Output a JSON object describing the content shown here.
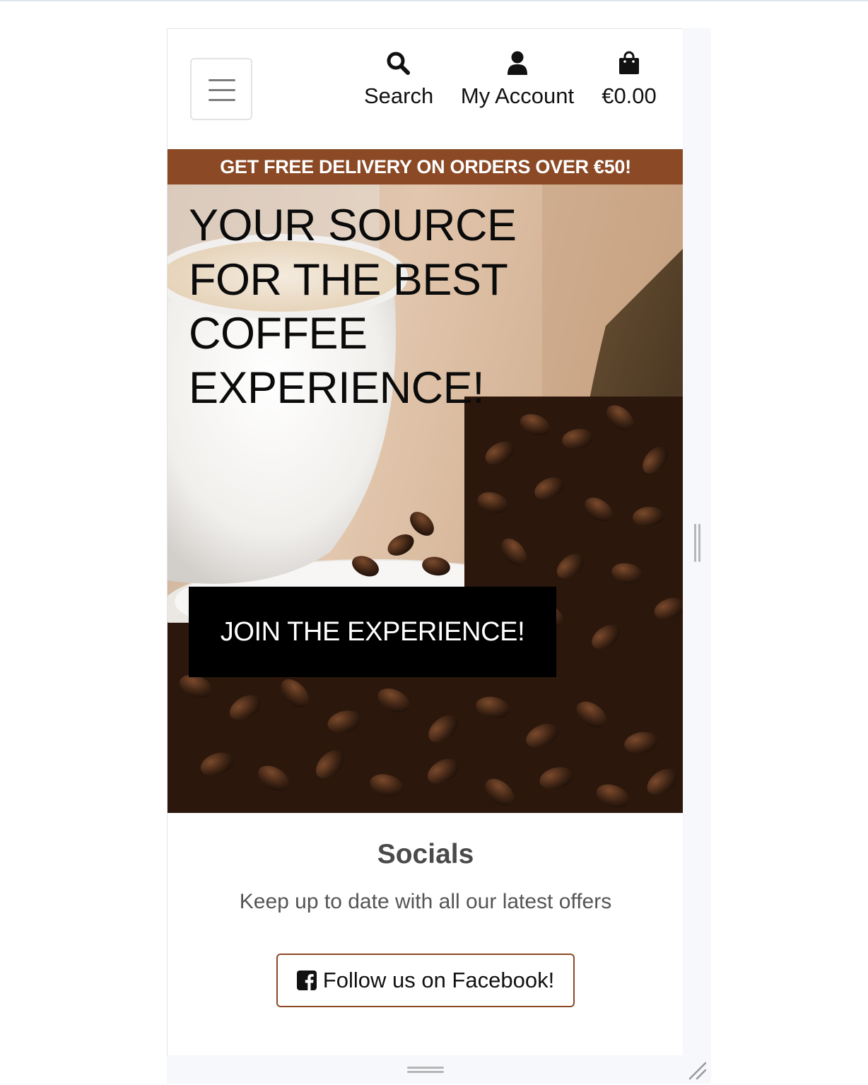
{
  "header": {
    "menu_icon": "hamburger-menu-icon",
    "nav": [
      {
        "label": "Search",
        "icon": "search-icon"
      },
      {
        "label": "My Account",
        "icon": "user-icon"
      },
      {
        "label": "€0.00",
        "icon": "shopping-bag-icon"
      }
    ]
  },
  "banner": {
    "text": "GET FREE DELIVERY ON ORDERS OVER €50!",
    "background": "#8b4926"
  },
  "hero": {
    "title": "YOUR SOURCE FOR THE BEST COFFEE EXPERIENCE!",
    "cta_label": "JOIN THE EXPERIENCE!"
  },
  "socials": {
    "title": "Socials",
    "subtitle": "Keep up to date with all our latest offers",
    "facebook_button": {
      "label": "Follow us on Facebook!",
      "icon": "facebook-square-icon",
      "border_color": "#8b4926"
    }
  },
  "colors": {
    "accent": "#8b4926",
    "cta_background": "#000000"
  }
}
